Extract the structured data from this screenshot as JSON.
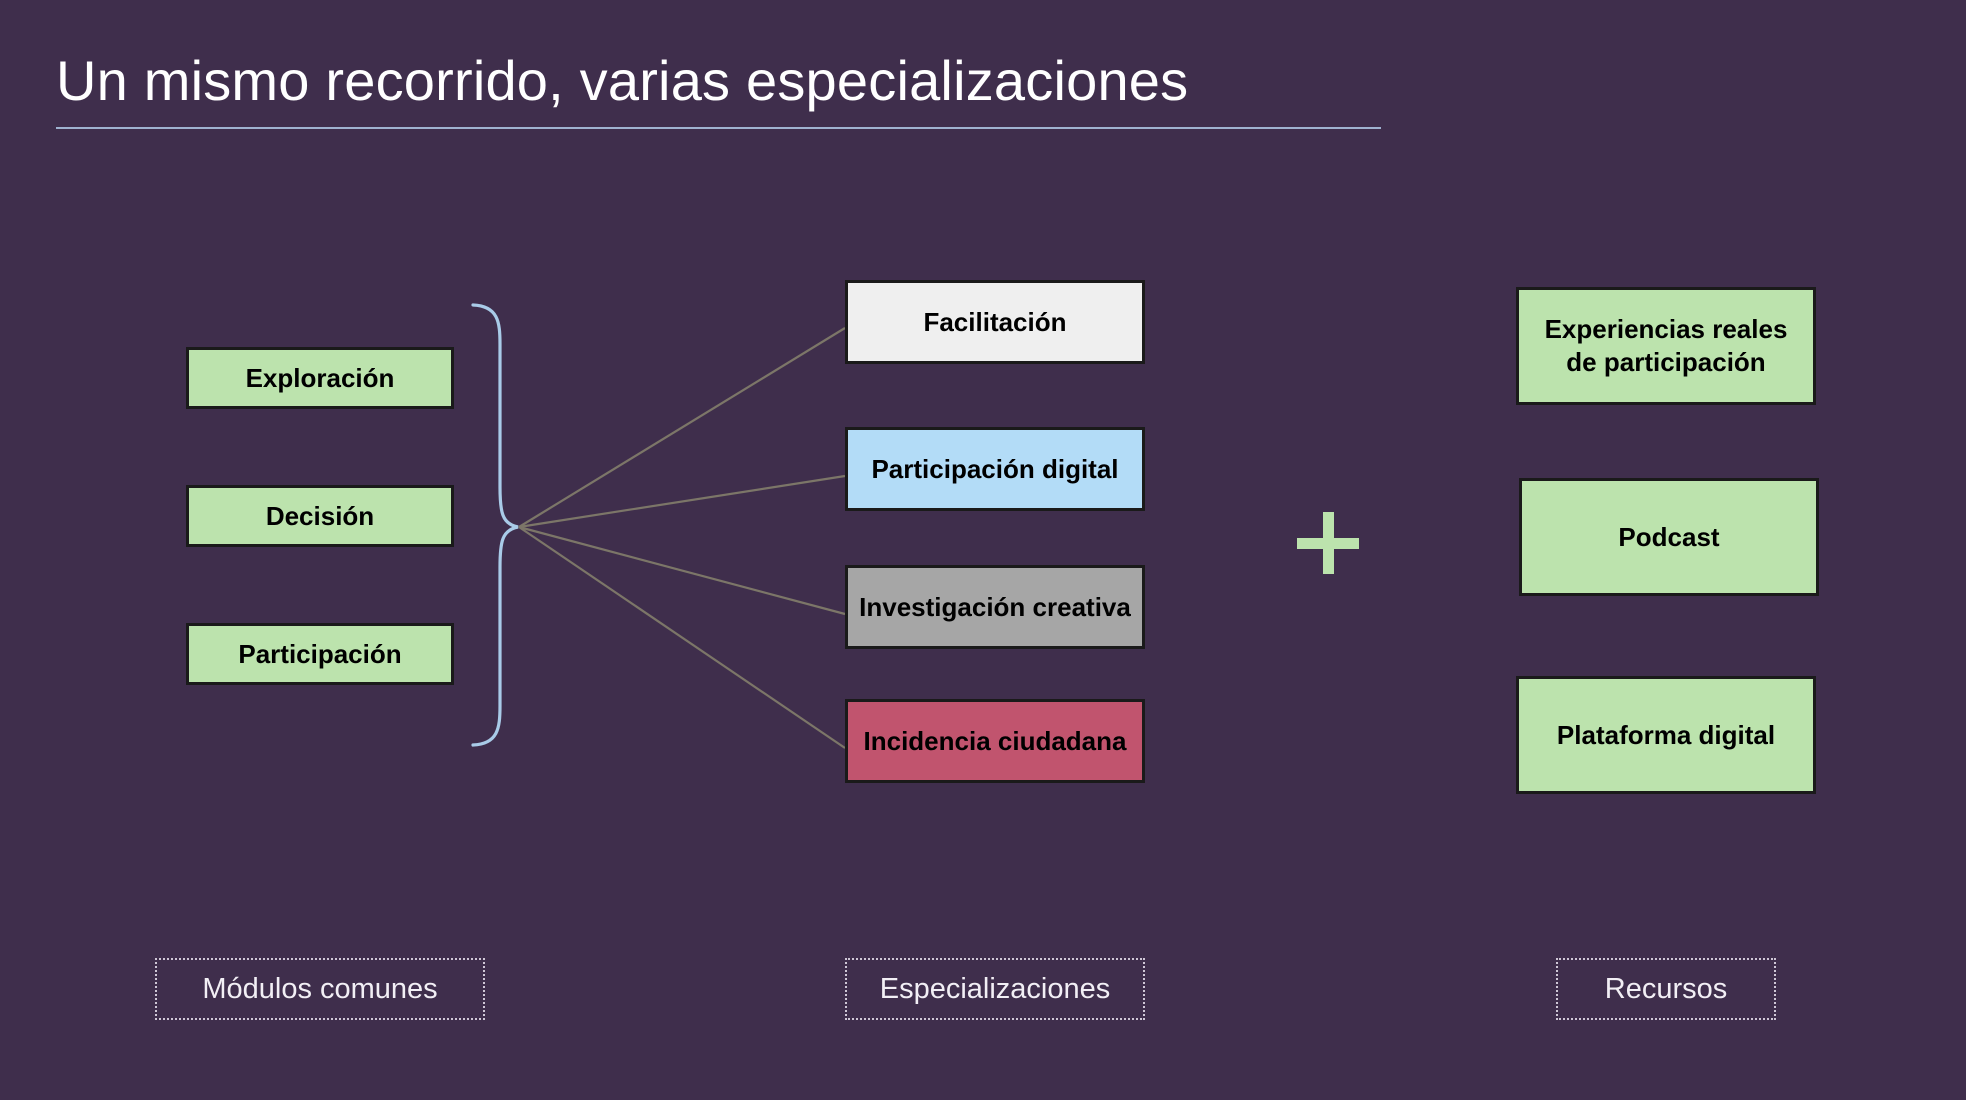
{
  "slide": {
    "title": "Un mismo recorrido, varias especializaciones",
    "background_color": "#3f2e4c",
    "title_rule_color": "#9fb2d0"
  },
  "colors": {
    "green": "#bce3ad",
    "white": "#efefef",
    "blue": "#b3dcf7",
    "gray": "#a6a6a6",
    "crimson": "#c1546e",
    "brace": "#a9cbe8",
    "connector_line": "#7c7668",
    "box_border": "#1a1a1a"
  },
  "columns": {
    "common_modules": {
      "legend": "Módulos comunes",
      "items": [
        {
          "label": "Exploración",
          "color": "#bce3ad"
        },
        {
          "label": "Decisión",
          "color": "#bce3ad"
        },
        {
          "label": "Participación",
          "color": "#bce3ad"
        }
      ]
    },
    "specializations": {
      "legend": "Especializaciones",
      "items": [
        {
          "label": "Facilitación",
          "color": "#efefef"
        },
        {
          "label": "Participación digital",
          "color": "#b3dcf7"
        },
        {
          "label": "Investigación creativa",
          "color": "#a6a6a6"
        },
        {
          "label": "Incidencia ciudadana",
          "color": "#c1546e"
        }
      ]
    },
    "resources": {
      "legend": "Recursos",
      "items": [
        {
          "label": "Experiencias reales de participación",
          "color": "#bce3ad"
        },
        {
          "label": "Podcast",
          "color": "#bce3ad"
        },
        {
          "label": "Plataforma digital",
          "color": "#bce3ad"
        }
      ]
    }
  },
  "operator": {
    "symbol": "+",
    "color": "#bce3ad"
  }
}
